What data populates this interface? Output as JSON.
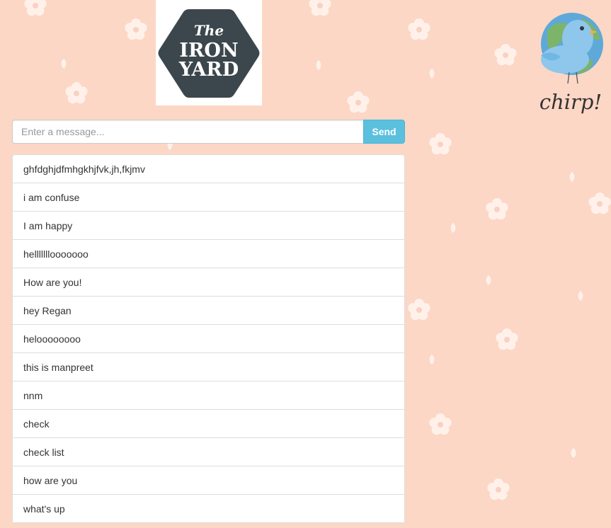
{
  "brand": {
    "iron_yard_logo": {
      "line1": "The",
      "line2": "IRON",
      "line3": "YARD"
    },
    "chirp_logo_text": "chirp!"
  },
  "composer": {
    "input_value": "",
    "input_placeholder": "Enter a message...",
    "send_label": "Send"
  },
  "messages": [
    {
      "text": "ghfdghjdfmhgkhjfvk,jh,fkjmv"
    },
    {
      "text": "i am confuse"
    },
    {
      "text": "I am happy"
    },
    {
      "text": "helllllllooooooo"
    },
    {
      "text": "How are you!"
    },
    {
      "text": "hey Regan"
    },
    {
      "text": "heloooooooo"
    },
    {
      "text": "this is manpreet"
    },
    {
      "text": "nnm"
    },
    {
      "text": "check"
    },
    {
      "text": "check list"
    },
    {
      "text": "how are you"
    },
    {
      "text": "what's up"
    }
  ],
  "colors": {
    "background": "#fcd7c6",
    "pattern_flower": "#fff1ea",
    "send_button": "#5bc0de",
    "logo_hexagon": "#3b474c",
    "bird_blue": "#6fb8e6",
    "globe_green": "#7cb46a"
  }
}
